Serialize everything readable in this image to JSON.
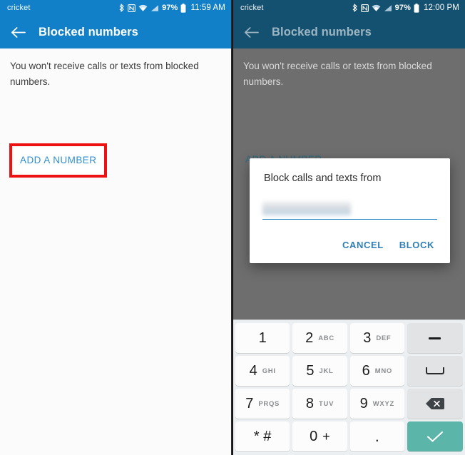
{
  "panels": {
    "left": {
      "statusbar": {
        "carrier": "cricket",
        "battery": "97%",
        "time": "11:59 AM",
        "icons": [
          "bluetooth-icon",
          "nfc-icon",
          "wifi-icon",
          "cellular-signal-icon",
          "battery-icon"
        ]
      },
      "appbar": {
        "title": "Blocked numbers",
        "back_icon": "arrow-back-icon"
      },
      "description": "You won't receive calls or texts from blocked numbers.",
      "add_number_label": "ADD A NUMBER",
      "highlight_color": "#ee1111"
    },
    "right": {
      "statusbar": {
        "carrier": "cricket",
        "battery": "97%",
        "time": "12:00 PM",
        "icons": [
          "bluetooth-icon",
          "nfc-icon",
          "wifi-icon",
          "cellular-signal-icon",
          "battery-icon"
        ]
      },
      "appbar": {
        "title": "Blocked numbers",
        "back_icon": "arrow-back-icon"
      },
      "description": "You won't receive calls or texts from blocked numbers.",
      "add_number_label": "ADD A NUMBER"
    }
  },
  "dialog": {
    "title": "Block calls and texts from",
    "input_value": "",
    "input_redacted": true,
    "cancel_label": "CANCEL",
    "block_label": "BLOCK",
    "accent_color": "#2f7fb8"
  },
  "keyboard": {
    "rows": [
      [
        {
          "digit": "1",
          "letters": ""
        },
        {
          "digit": "2",
          "letters": "ABC"
        },
        {
          "digit": "3",
          "letters": "DEF"
        },
        {
          "icon": "dash-key-icon",
          "type": "func"
        }
      ],
      [
        {
          "digit": "4",
          "letters": "GHI"
        },
        {
          "digit": "5",
          "letters": "JKL"
        },
        {
          "digit": "6",
          "letters": "MNO"
        },
        {
          "icon": "space-key-icon",
          "type": "func"
        }
      ],
      [
        {
          "digit": "7",
          "letters": "PRQS"
        },
        {
          "digit": "8",
          "letters": "TUV"
        },
        {
          "digit": "9",
          "letters": "WXYZ"
        },
        {
          "icon": "backspace-key-icon",
          "type": "func"
        }
      ],
      [
        {
          "digit": "* #",
          "letters": ""
        },
        {
          "digit": "0",
          "letters": "+"
        },
        {
          "digit": ".",
          "letters": ""
        },
        {
          "icon": "enter-check-key-icon",
          "type": "enter"
        }
      ]
    ],
    "enter_color": "#5bb5a8"
  },
  "theme": {
    "appbar_blue": "#1280c8",
    "appbar_dimmed": "#14506f",
    "link_blue": "#2f8fd0"
  }
}
